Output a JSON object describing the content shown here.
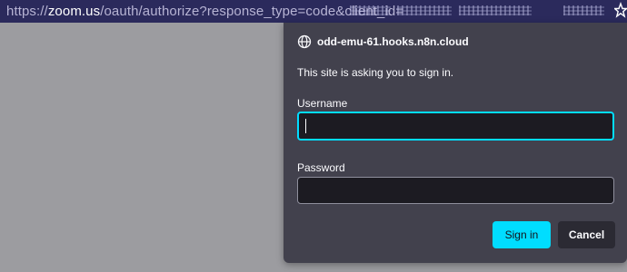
{
  "urlbar": {
    "url_prefix": "https://",
    "url_domain": "zoom.us",
    "url_path": "/oauth/authorize?response_type=code&client_id="
  },
  "dialog": {
    "site": "odd-emu-61.hooks.n8n.cloud",
    "message": "This site is asking you to sign in.",
    "username_label": "Username",
    "username_value": "",
    "password_label": "Password",
    "password_value": "",
    "sign_in_label": "Sign in",
    "cancel_label": "Cancel"
  },
  "colors": {
    "accent": "#00ddff",
    "dialog_bg": "#42414d",
    "urlbar_bg": "#2b2a5c"
  },
  "icons": {
    "site": "globe-icon",
    "bookmark": "star-icon"
  }
}
